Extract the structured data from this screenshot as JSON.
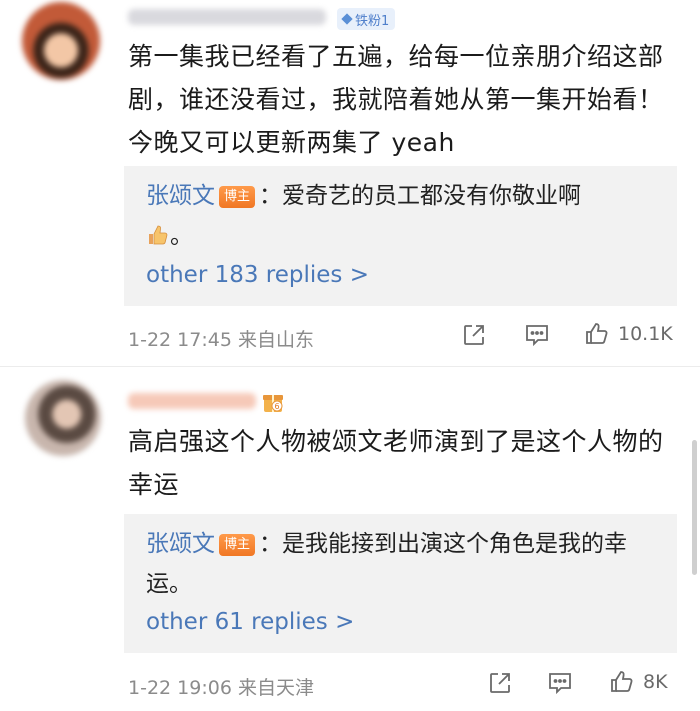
{
  "comments": [
    {
      "fan_badge": "铁粉1",
      "text": "第一集我已经看了五遍，给每一位亲朋介绍这部剧，谁还没看过，我就陪着她从第一集开始看！今晚又可以更新两集了 yeah",
      "reply": {
        "author": "张颂文",
        "badge": "博主",
        "text": "：爱奇艺的员工都没有你敬业啊",
        "suffix": "。"
      },
      "more_replies": "other 183 replies >",
      "time": "1-22 17:45",
      "location": "来自山东",
      "likes": "10.1K"
    },
    {
      "text": "高启强这个人物被颂文老师演到了是这个人物的幸运",
      "reply": {
        "author": "张颂文",
        "badge": "博主",
        "text": "：是我能接到出演这个角色是我的幸运。"
      },
      "more_replies": "other 61 replies >",
      "time": "1-22 19:06",
      "location": "来自天津",
      "likes": "8K"
    }
  ],
  "icons": {
    "fan_badge": "diamond-icon",
    "user_badge": "gift-badge-icon",
    "emoji": "thumbs-up-emoji",
    "share": "share-icon",
    "comment": "comment-icon",
    "like": "like-icon"
  },
  "colors": {
    "link": "#4a78b8",
    "badge_orange": "#f07724",
    "meta_gray": "#8b8b8b",
    "reply_bg": "#f2f2f2"
  }
}
